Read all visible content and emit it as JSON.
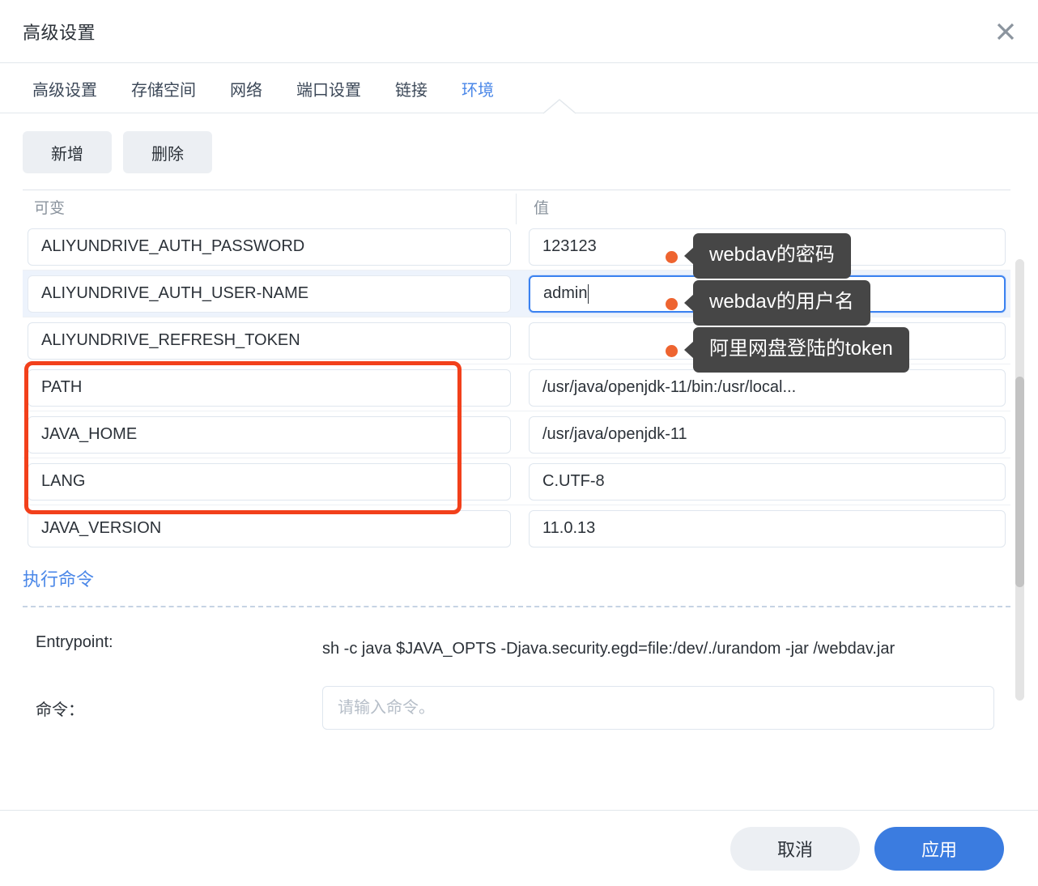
{
  "dialog": {
    "title": "高级设置",
    "close_icon": "close-icon"
  },
  "tabs": [
    {
      "label": "高级设置",
      "active": false
    },
    {
      "label": "存储空间",
      "active": false
    },
    {
      "label": "网络",
      "active": false
    },
    {
      "label": "端口设置",
      "active": false
    },
    {
      "label": "链接",
      "active": false
    },
    {
      "label": "环境",
      "active": true
    }
  ],
  "toolbar": {
    "add_label": "新增",
    "delete_label": "删除"
  },
  "table": {
    "columns": [
      "可变",
      "值"
    ],
    "rows": [
      {
        "variable": "ALIYUNDRIVE_AUTH_PASSWORD",
        "value": "123123",
        "selected": false,
        "focused": false
      },
      {
        "variable": "ALIYUNDRIVE_AUTH_USER-NAME",
        "value": "admin",
        "selected": true,
        "focused": true
      },
      {
        "variable": "ALIYUNDRIVE_REFRESH_TOKEN",
        "value": "",
        "selected": false,
        "focused": false
      },
      {
        "variable": "PATH",
        "value": "/usr/java/openjdk-11/bin:/usr/local...",
        "selected": false,
        "focused": false
      },
      {
        "variable": "JAVA_HOME",
        "value": "/usr/java/openjdk-11",
        "selected": false,
        "focused": false
      },
      {
        "variable": "LANG",
        "value": "C.UTF-8",
        "selected": false,
        "focused": false
      },
      {
        "variable": "JAVA_VERSION",
        "value": "11.0.13",
        "selected": false,
        "focused": false
      }
    ]
  },
  "annotations": {
    "tooltips": [
      {
        "text": "webdav的密码"
      },
      {
        "text": "webdav的用户名"
      },
      {
        "text": "阿里网盘登陆的token"
      }
    ],
    "highlight_color": "#f2401b",
    "dot_color": "#ee6430",
    "tooltip_bg": "#464646"
  },
  "exec": {
    "section_title": "执行命令",
    "entrypoint_label": "Entrypoint:",
    "entrypoint_value": "sh -c java $JAVA_OPTS -Djava.security.egd=file:/dev/./urandom -jar /webdav.jar",
    "command_label": "命令：",
    "command_value": "",
    "command_placeholder": "请输入命令。"
  },
  "footer": {
    "cancel_label": "取消",
    "apply_label": "应用"
  },
  "colors": {
    "accent": "#3b7ce0",
    "tab_active": "#4a87e8",
    "link": "#4a87e8"
  }
}
